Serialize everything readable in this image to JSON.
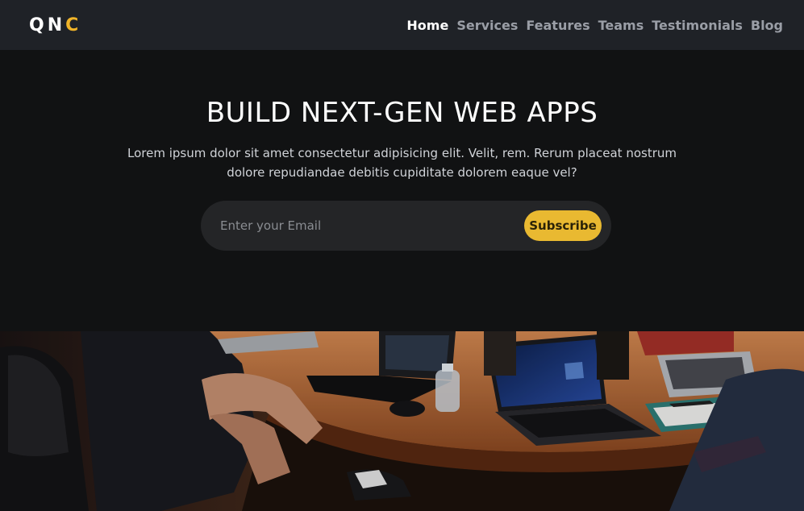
{
  "brand": {
    "logo_main": "QN",
    "logo_accent": "C"
  },
  "nav": {
    "items": [
      {
        "label": "Home",
        "active": true
      },
      {
        "label": "Services",
        "active": false
      },
      {
        "label": "Features",
        "active": false
      },
      {
        "label": "Teams",
        "active": false
      },
      {
        "label": "Testimonials",
        "active": false
      },
      {
        "label": "Blog",
        "active": false
      }
    ]
  },
  "hero": {
    "title": "BUILD NEXT-GEN WEB APPS",
    "subtitle": "Lorem ipsum dolor sit amet consectetur adipisicing elit. Velit, rem. Rerum placeat nostrum dolore repudiandae debitis cupiditate dolorem eaque vel?",
    "email_placeholder": "Enter your Email",
    "subscribe_label": "Subscribe"
  },
  "colors": {
    "accent": "#e9b931",
    "navbar_bg": "#1f2227",
    "hero_bg": "#111213"
  }
}
